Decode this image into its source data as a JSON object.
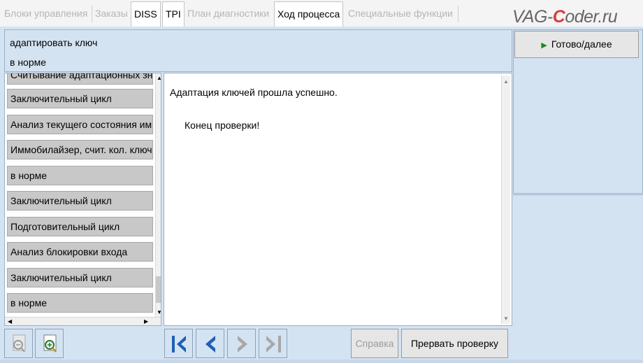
{
  "tabs": [
    {
      "label": "Блоки управления",
      "state": "disabled"
    },
    {
      "label": "Заказы",
      "state": "disabled"
    },
    {
      "label": "DISS",
      "state": "enabled"
    },
    {
      "label": "TPI",
      "state": "enabled"
    },
    {
      "label": "План диагностики",
      "state": "disabled"
    },
    {
      "label": "Ход процесса",
      "state": "active"
    },
    {
      "label": "Специальные функции",
      "state": "disabled"
    }
  ],
  "logo": {
    "prefix": "VAG-",
    "accent": "C",
    "suffix": "oder.ru"
  },
  "header": {
    "line1": "адаптировать ключ",
    "line2": "в норме"
  },
  "right_panel": {
    "next_label": "Готово/далее",
    "next_icon": "play-triangle-icon"
  },
  "steps": [
    "Считывание адаптационных значений",
    "Заключительный цикл",
    "Анализ текущего состояния иммобилайзера",
    "Иммобилайзер, счит. кол. ключей",
    "в норме",
    "Заключительный цикл",
    "Подготовительный цикл",
    "Анализ блокировки входа",
    "Заключительный цикл",
    "в норме"
  ],
  "main": {
    "message1": "Адаптация ключей прошла успешно.",
    "message2": "Конец проверки!"
  },
  "toolbar": {
    "zoom_out_icon": "zoom-out-icon",
    "zoom_in_icon": "zoom-in-icon",
    "first_icon": "skip-first-icon",
    "prev_icon": "previous-icon",
    "next_icon": "next-icon",
    "last_icon": "skip-last-icon",
    "help_label": "Справка",
    "abort_label": "Прервать проверку"
  },
  "colors": {
    "accent_blue": "#1f5fb5",
    "logo_red": "#d93c3c",
    "panel_bg": "#d4e3f2"
  }
}
